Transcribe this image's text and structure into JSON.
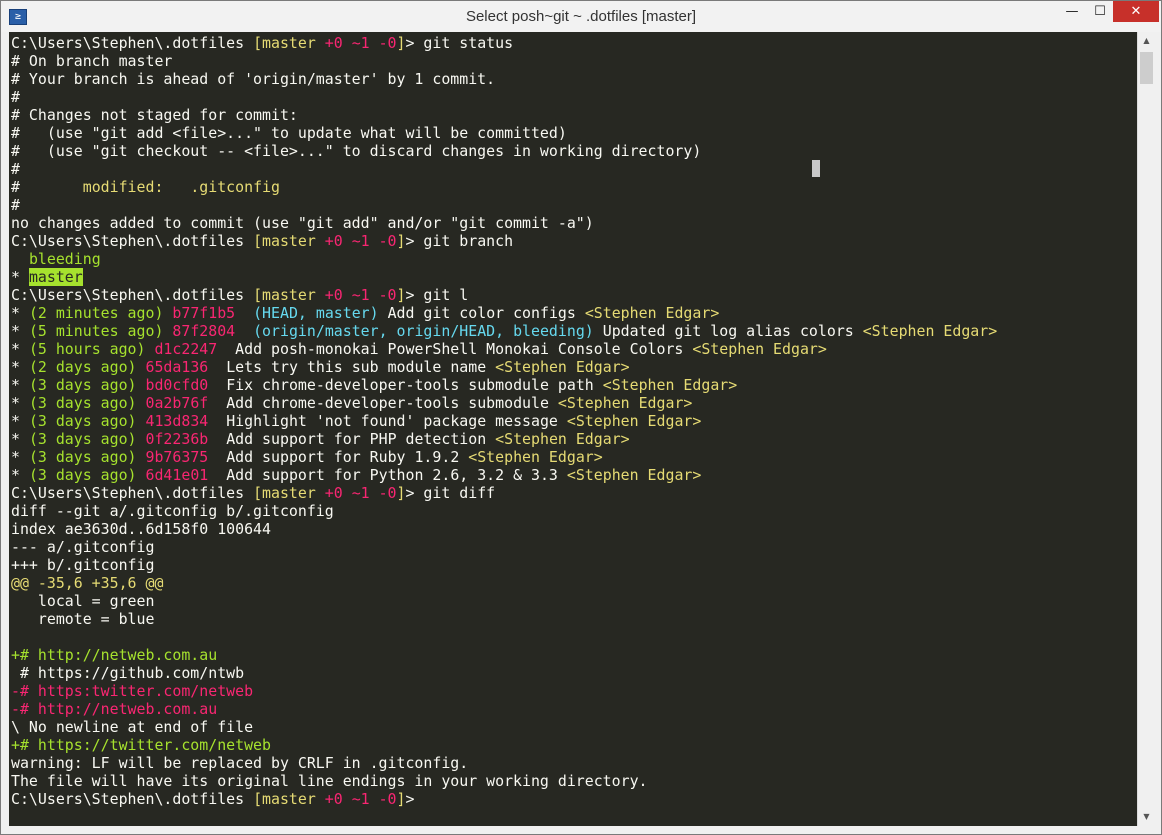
{
  "window": {
    "title": "Select posh~git ~ .dotfiles [master]",
    "app_icon_glyph": "≥",
    "controls": {
      "minimize": "—",
      "maximize": "☐",
      "close": "✕"
    }
  },
  "scrollbar": {
    "up_arrow": "▲",
    "down_arrow": "▼"
  },
  "colors": {
    "background": "#272822",
    "default": "#f8f8f2",
    "yellow": "#e6db74",
    "green": "#a6e22e",
    "magenta": "#f92672",
    "cyan": "#66d9ef",
    "close_button": "#c7302a"
  },
  "terminal": {
    "lines": [
      [
        {
          "t": "C:\\Users\\Stephen\\.dotfiles ",
          "c": "default"
        },
        {
          "t": "[master ",
          "c": "yellow"
        },
        {
          "t": "+0 ~1 -0",
          "c": "magenta"
        },
        {
          "t": "]",
          "c": "yellow"
        },
        {
          "t": "> git status",
          "c": "default"
        }
      ],
      [
        {
          "t": "# On branch master",
          "c": "default"
        }
      ],
      [
        {
          "t": "# Your branch is ahead of 'origin/master' by 1 commit.",
          "c": "default"
        }
      ],
      [
        {
          "t": "#",
          "c": "default"
        }
      ],
      [
        {
          "t": "# Changes not staged for commit:",
          "c": "default"
        }
      ],
      [
        {
          "t": "#   (use \"git add <file>...\" to update what will be committed)",
          "c": "default"
        }
      ],
      [
        {
          "t": "#   (use \"git checkout -- <file>...\" to discard changes in working directory)",
          "c": "default"
        }
      ],
      [
        {
          "t": "#",
          "c": "default"
        }
      ],
      [
        {
          "t": "#       ",
          "c": "default"
        },
        {
          "t": "modified:   .gitconfig",
          "c": "yellow"
        }
      ],
      [
        {
          "t": "#",
          "c": "default"
        }
      ],
      [
        {
          "t": "no changes added to commit (use \"git add\" and/or \"git commit -a\")",
          "c": "default"
        }
      ],
      [
        {
          "t": "C:\\Users\\Stephen\\.dotfiles ",
          "c": "default"
        },
        {
          "t": "[master ",
          "c": "yellow"
        },
        {
          "t": "+0 ~1 -0",
          "c": "magenta"
        },
        {
          "t": "]",
          "c": "yellow"
        },
        {
          "t": "> git branch",
          "c": "default"
        }
      ],
      [
        {
          "t": "  ",
          "c": "default"
        },
        {
          "t": "bleeding",
          "c": "green"
        }
      ],
      [
        {
          "t": "* ",
          "c": "default"
        },
        {
          "t": "master",
          "c": "hl"
        }
      ],
      [
        {
          "t": "C:\\Users\\Stephen\\.dotfiles ",
          "c": "default"
        },
        {
          "t": "[master ",
          "c": "yellow"
        },
        {
          "t": "+0 ~1 -0",
          "c": "magenta"
        },
        {
          "t": "]",
          "c": "yellow"
        },
        {
          "t": "> git l",
          "c": "default"
        }
      ],
      [
        {
          "t": "* ",
          "c": "default"
        },
        {
          "t": "(2 minutes ago)",
          "c": "green"
        },
        {
          "t": " ",
          "c": "default"
        },
        {
          "t": "b77f1b5",
          "c": "magenta"
        },
        {
          "t": "  ",
          "c": "default"
        },
        {
          "t": "(HEAD, master)",
          "c": "cyan"
        },
        {
          "t": " Add git color configs ",
          "c": "default"
        },
        {
          "t": "<Stephen Edgar>",
          "c": "yellow"
        }
      ],
      [
        {
          "t": "* ",
          "c": "default"
        },
        {
          "t": "(5 minutes ago)",
          "c": "green"
        },
        {
          "t": " ",
          "c": "default"
        },
        {
          "t": "87f2804",
          "c": "magenta"
        },
        {
          "t": "  ",
          "c": "default"
        },
        {
          "t": "(origin/master, origin/HEAD, bleeding)",
          "c": "cyan"
        },
        {
          "t": " Updated git log alias colors ",
          "c": "default"
        },
        {
          "t": "<Stephen Edgar>",
          "c": "yellow"
        }
      ],
      [
        {
          "t": "* ",
          "c": "default"
        },
        {
          "t": "(5 hours ago)",
          "c": "green"
        },
        {
          "t": " ",
          "c": "default"
        },
        {
          "t": "d1c2247",
          "c": "magenta"
        },
        {
          "t": "  Add posh-monokai PowerShell Monokai Console Colors ",
          "c": "default"
        },
        {
          "t": "<Stephen Edgar>",
          "c": "yellow"
        }
      ],
      [
        {
          "t": "* ",
          "c": "default"
        },
        {
          "t": "(2 days ago)",
          "c": "green"
        },
        {
          "t": " ",
          "c": "default"
        },
        {
          "t": "65da136",
          "c": "magenta"
        },
        {
          "t": "  Lets try this sub module name ",
          "c": "default"
        },
        {
          "t": "<Stephen Edgar>",
          "c": "yellow"
        }
      ],
      [
        {
          "t": "* ",
          "c": "default"
        },
        {
          "t": "(3 days ago)",
          "c": "green"
        },
        {
          "t": " ",
          "c": "default"
        },
        {
          "t": "bd0cfd0",
          "c": "magenta"
        },
        {
          "t": "  Fix chrome-developer-tools submodule path ",
          "c": "default"
        },
        {
          "t": "<Stephen Edgar>",
          "c": "yellow"
        }
      ],
      [
        {
          "t": "* ",
          "c": "default"
        },
        {
          "t": "(3 days ago)",
          "c": "green"
        },
        {
          "t": " ",
          "c": "default"
        },
        {
          "t": "0a2b76f",
          "c": "magenta"
        },
        {
          "t": "  Add chrome-developer-tools submodule ",
          "c": "default"
        },
        {
          "t": "<Stephen Edgar>",
          "c": "yellow"
        }
      ],
      [
        {
          "t": "* ",
          "c": "default"
        },
        {
          "t": "(3 days ago)",
          "c": "green"
        },
        {
          "t": " ",
          "c": "default"
        },
        {
          "t": "413d834",
          "c": "magenta"
        },
        {
          "t": "  Highlight 'not found' package message ",
          "c": "default"
        },
        {
          "t": "<Stephen Edgar>",
          "c": "yellow"
        }
      ],
      [
        {
          "t": "* ",
          "c": "default"
        },
        {
          "t": "(3 days ago)",
          "c": "green"
        },
        {
          "t": " ",
          "c": "default"
        },
        {
          "t": "0f2236b",
          "c": "magenta"
        },
        {
          "t": "  Add support for PHP detection ",
          "c": "default"
        },
        {
          "t": "<Stephen Edgar>",
          "c": "yellow"
        }
      ],
      [
        {
          "t": "* ",
          "c": "default"
        },
        {
          "t": "(3 days ago)",
          "c": "green"
        },
        {
          "t": " ",
          "c": "default"
        },
        {
          "t": "9b76375",
          "c": "magenta"
        },
        {
          "t": "  Add support for Ruby 1.9.2 ",
          "c": "default"
        },
        {
          "t": "<Stephen Edgar>",
          "c": "yellow"
        }
      ],
      [
        {
          "t": "* ",
          "c": "default"
        },
        {
          "t": "(3 days ago)",
          "c": "green"
        },
        {
          "t": " ",
          "c": "default"
        },
        {
          "t": "6d41e01",
          "c": "magenta"
        },
        {
          "t": "  Add support for Python 2.6, 3.2 & 3.3 ",
          "c": "default"
        },
        {
          "t": "<Stephen Edgar>",
          "c": "yellow"
        }
      ],
      [
        {
          "t": "C:\\Users\\Stephen\\.dotfiles ",
          "c": "default"
        },
        {
          "t": "[master ",
          "c": "yellow"
        },
        {
          "t": "+0 ~1 -0",
          "c": "magenta"
        },
        {
          "t": "]",
          "c": "yellow"
        },
        {
          "t": "> git diff",
          "c": "default"
        }
      ],
      [
        {
          "t": "diff --git a/.gitconfig b/.gitconfig",
          "c": "default"
        }
      ],
      [
        {
          "t": "index ae3630d..6d158f0 100644",
          "c": "default"
        }
      ],
      [
        {
          "t": "--- a/.gitconfig",
          "c": "default"
        }
      ],
      [
        {
          "t": "+++ b/.gitconfig",
          "c": "default"
        }
      ],
      [
        {
          "t": "@@ -35,6 +35,6 @@",
          "c": "yellow"
        }
      ],
      [
        {
          "t": "   local = green",
          "c": "default"
        }
      ],
      [
        {
          "t": "   remote = blue",
          "c": "default"
        }
      ],
      [
        {
          "t": "",
          "c": "default"
        }
      ],
      [
        {
          "t": "+# http://netweb.com.au",
          "c": "green"
        }
      ],
      [
        {
          "t": " # https://github.com/ntwb",
          "c": "default"
        }
      ],
      [
        {
          "t": "-# https:twitter.com/netweb",
          "c": "magenta"
        }
      ],
      [
        {
          "t": "-# http://netweb.com.au",
          "c": "magenta"
        }
      ],
      [
        {
          "t": "\\ No newline at end of file",
          "c": "default"
        }
      ],
      [
        {
          "t": "+# https://twitter.com/netweb",
          "c": "green"
        }
      ],
      [
        {
          "t": "warning: LF will be replaced by CRLF in .gitconfig.",
          "c": "default"
        }
      ],
      [
        {
          "t": "The file will have its original line endings in your working directory.",
          "c": "default"
        }
      ],
      [
        {
          "t": "C:\\Users\\Stephen\\.dotfiles ",
          "c": "default"
        },
        {
          "t": "[master ",
          "c": "yellow"
        },
        {
          "t": "+0 ~1 -0",
          "c": "magenta"
        },
        {
          "t": "]",
          "c": "yellow"
        },
        {
          "t": ">",
          "c": "default"
        }
      ]
    ]
  }
}
